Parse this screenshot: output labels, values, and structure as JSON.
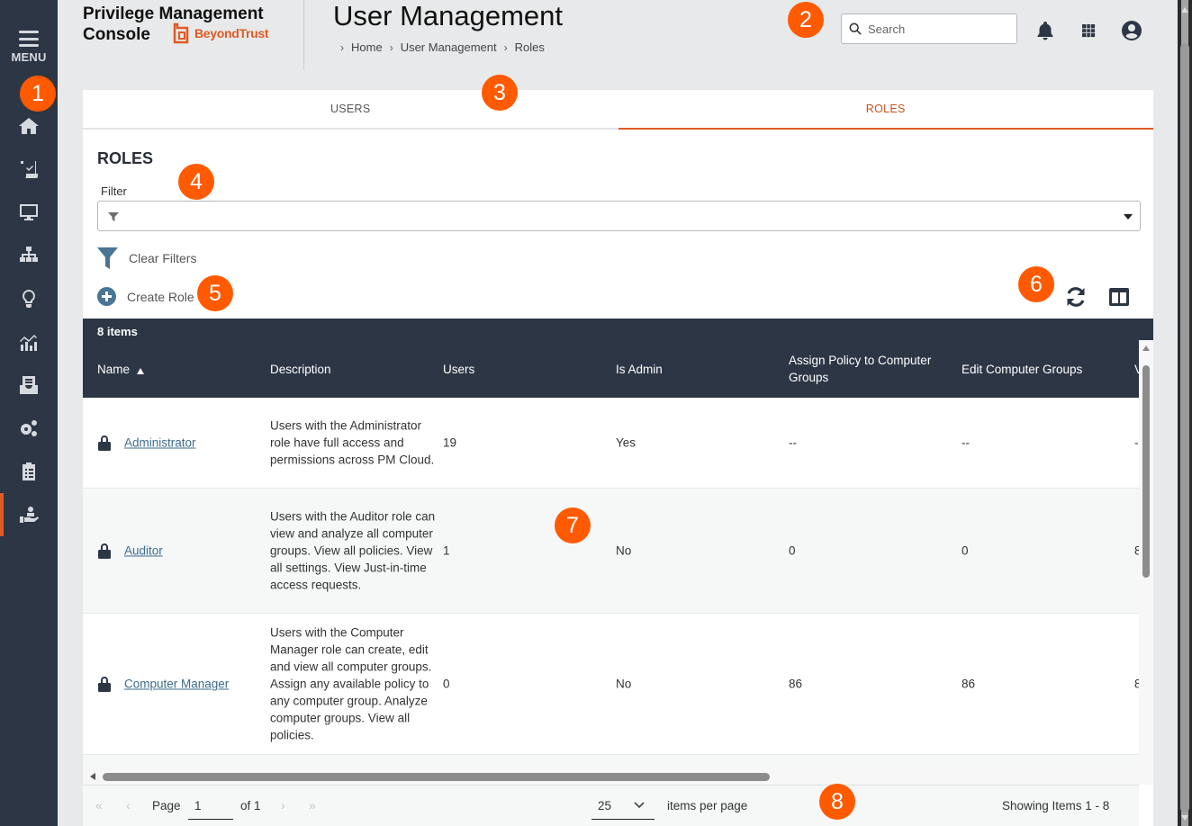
{
  "app": {
    "brand_line1": "Privilege Management",
    "brand_line2": "Console",
    "logo_text": "BeyondTrust",
    "accent_color": "#e05a24",
    "sidebar_color": "#2d3645",
    "badge_color": "#ff5a00"
  },
  "sidebar": {
    "menu_label": "MENU",
    "items": [
      {
        "icon": "home-icon",
        "label": "Home",
        "active": false
      },
      {
        "icon": "policy-scroll-icon",
        "label": "Policies",
        "active": false
      },
      {
        "icon": "computer-icon",
        "label": "Computers",
        "active": false
      },
      {
        "icon": "hierarchy-icon",
        "label": "Groups",
        "active": false
      },
      {
        "icon": "lightbulb-icon",
        "label": "Analytics",
        "active": false
      },
      {
        "icon": "chart-icon",
        "label": "Reports",
        "active": false
      },
      {
        "icon": "inbox-icon",
        "label": "Requests",
        "active": false
      },
      {
        "icon": "gears-icon",
        "label": "Configuration",
        "active": false
      },
      {
        "icon": "clipboard-icon",
        "label": "Activity Audits",
        "active": false
      },
      {
        "icon": "user-hand-icon",
        "label": "User Management",
        "active": true
      }
    ]
  },
  "header": {
    "title": "User Management",
    "breadcrumb": [
      "Home",
      "User Management",
      "Roles"
    ],
    "search_placeholder": "Search",
    "search_value": ""
  },
  "tabs": [
    {
      "label": "USERS",
      "active": false
    },
    {
      "label": "ROLES",
      "active": true
    }
  ],
  "roles": {
    "section_title": "ROLES",
    "filter_label": "Filter",
    "clear_filters_label": "Clear Filters",
    "create_role_label": "Create Role"
  },
  "grid": {
    "items_count": "8 items",
    "columns": [
      {
        "label": "Name",
        "sorted": "asc"
      },
      {
        "label": "Description"
      },
      {
        "label": "Users"
      },
      {
        "label": "Is Admin"
      },
      {
        "label": "Assign Policy to Computer Groups"
      },
      {
        "label": "Edit Computer Groups"
      },
      {
        "label": "V"
      }
    ],
    "rows": [
      {
        "name": "Administrator",
        "description": "Users with the Administrator role have full access and permissions across PM Cloud.",
        "users": "19",
        "is_admin": "Yes",
        "assign_policy": "--",
        "edit_groups": "--",
        "next_col": "-"
      },
      {
        "name": "Auditor",
        "description": "Users with the Auditor role can view and analyze all computer groups. View all policies. View all settings. View Just-in-time access requests.",
        "users": "1",
        "is_admin": "No",
        "assign_policy": "0",
        "edit_groups": "0",
        "next_col": "8"
      },
      {
        "name": "Computer Manager",
        "description": "Users with the Computer Manager role can create, edit and view all computer groups. Assign any available policy to any computer group. Analyze computer groups. View all policies.",
        "users": "0",
        "is_admin": "No",
        "assign_policy": "86",
        "edit_groups": "86",
        "next_col": "8"
      }
    ]
  },
  "pager": {
    "page_label": "Page",
    "page_value": "1",
    "of_label": "of 1",
    "page_size": "25",
    "items_per_page_label": "items per page",
    "showing": "Showing Items 1 - 8",
    "first": "«",
    "prev": "‹",
    "next": "›",
    "last": "»"
  },
  "annotations": [
    "1",
    "2",
    "3",
    "4",
    "5",
    "6",
    "7",
    "8"
  ]
}
